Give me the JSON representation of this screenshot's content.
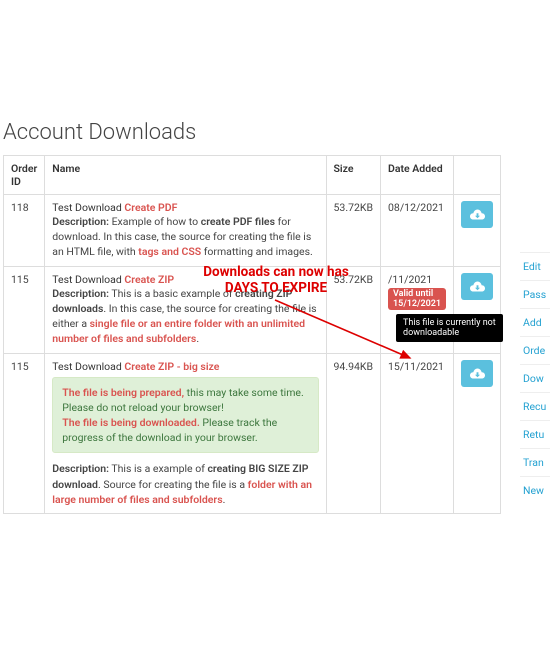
{
  "title": "Account Downloads",
  "annotation": {
    "line1": "Downloads can now has",
    "line2": "DAYS TO EXPIRE"
  },
  "tooltip": {
    "line1": "This file is currently not",
    "line2": "downloadable"
  },
  "columns": {
    "id": "Order ID",
    "name": "Name",
    "size": "Size",
    "date": "Date Added"
  },
  "rows": [
    {
      "id": "118",
      "name_prefix": "Test Download ",
      "name_kw": "Create PDF",
      "desc_label": "Description:",
      "desc_1": " Example of how to ",
      "desc_b1": "create PDF files",
      "desc_2": " for download. In this case, the source for creating the file is an HTML file, with ",
      "desc_kw": "tags and CSS",
      "desc_3": " formatting and images.",
      "size": "53.72KB",
      "date": "08/12/2021"
    },
    {
      "id": "115",
      "name_prefix": "Test Download ",
      "name_kw": "Create ZIP",
      "desc_label": "Description:",
      "desc_1": " This is a basic example of ",
      "desc_b1": "creating ZIP downloads",
      "desc_2": ". In this case, the source for creating the file is either a ",
      "desc_kw": "single file or an entire folder with an unlimited number of files and subfolders",
      "desc_3": ".",
      "size": "53.72KB",
      "date_partial": "/11/2021",
      "badge": "Valid until 15/12/2021"
    },
    {
      "id": "115",
      "name_prefix": "Test Download ",
      "name_kw": "Create ZIP - big size",
      "alert_w1": "The file is being prepared,",
      "alert_t1": " this may take some time. Please do not reload your browser!",
      "alert_w2": "The file is being downloaded.",
      "alert_t2": " Please track the progress of the download in your browser.",
      "desc_label": "Description:",
      "desc_1": " This is a example of ",
      "desc_b1": "creating BIG SIZE ZIP download",
      "desc_2": ". Source for creating the file is a ",
      "desc_kw": "folder with an large number of files and subfolders",
      "desc_3": ".",
      "size": "94.94KB",
      "date": "15/11/2021"
    }
  ],
  "sidemenu": [
    "Edit",
    "Pass",
    "Add",
    "Orde",
    "Dow",
    "Recu",
    "Retu",
    "Tran",
    "New"
  ]
}
